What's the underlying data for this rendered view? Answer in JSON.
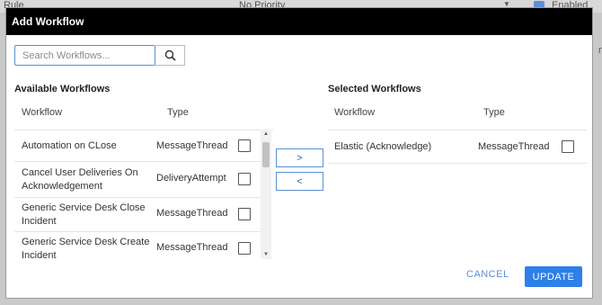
{
  "background": {
    "rule_label": "Rule",
    "priority_select": "No Priority",
    "enabled_label": "Enabled",
    "side_text": "nc"
  },
  "dialog": {
    "title": "Add Workflow",
    "search": {
      "placeholder": "Search Workflows...",
      "value": ""
    },
    "available": {
      "title": "Available Workflows",
      "col_workflow": "Workflow",
      "col_type": "Type",
      "rows": [
        {
          "name": "Automation on CLose",
          "type": "MessageThread",
          "checked": false
        },
        {
          "name": "Cancel User Deliveries On Acknowledgement",
          "type": "DeliveryAttempt",
          "checked": false
        },
        {
          "name": "Generic Service Desk Close Incident",
          "type": "MessageThread",
          "checked": false
        },
        {
          "name": "Generic Service Desk Create Incident",
          "type": "MessageThread",
          "checked": false
        }
      ]
    },
    "move_right_label": ">",
    "move_left_label": "<",
    "selected": {
      "title": "Selected Workflows",
      "col_workflow": "Workflow",
      "col_type": "Type",
      "rows": [
        {
          "name": "Elastic (Acknowledge)",
          "type": "MessageThread",
          "checked": false
        }
      ]
    },
    "cancel_label": "CANCEL",
    "update_label": "UPDATE"
  },
  "colors": {
    "accent": "#2e7fe8",
    "header_bg": "#000000",
    "link": "#5b8fd6"
  }
}
